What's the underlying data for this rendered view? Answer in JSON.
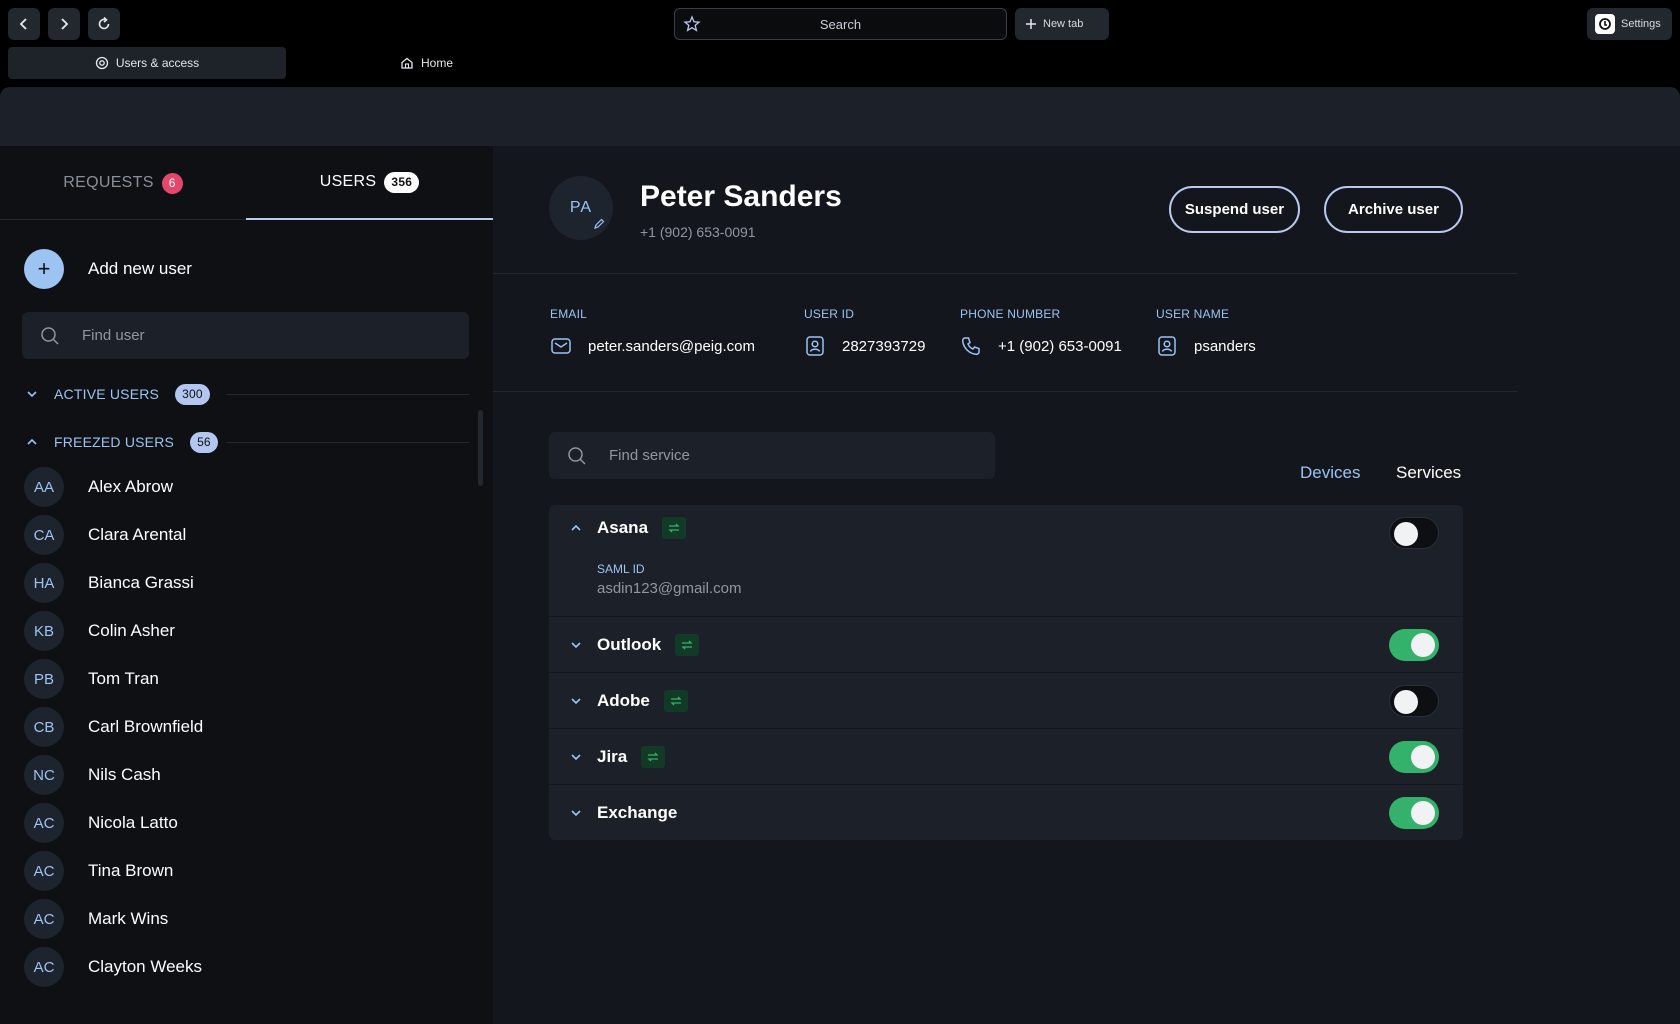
{
  "browser": {
    "search_label": "Search",
    "new_tab_label": "New tab",
    "settings_label": "Settings",
    "tabs": [
      {
        "label": "Users & access",
        "icon": "gear-icon",
        "active": true
      },
      {
        "label": "Home",
        "icon": "home-icon",
        "active": false
      }
    ]
  },
  "sidebar": {
    "tabs": [
      {
        "label": "REQUESTS",
        "count": "6"
      },
      {
        "label": "USERS",
        "count": "356"
      }
    ],
    "add_user_label": "Add new user",
    "find_user_placeholder": "Find user",
    "groups": [
      {
        "label": "ACTIVE USERS",
        "count": "300",
        "expanded": false
      },
      {
        "label": "FREEZED USERS",
        "count": "56",
        "expanded": true
      }
    ],
    "users": [
      {
        "initials": "AA",
        "name": "Alex Abrow"
      },
      {
        "initials": "CA",
        "name": "Clara Arental"
      },
      {
        "initials": "HA",
        "name": "Bianca Grassi"
      },
      {
        "initials": "KB",
        "name": "Colin Asher"
      },
      {
        "initials": "PB",
        "name": "Tom Tran"
      },
      {
        "initials": "CB",
        "name": "Carl Brownfield"
      },
      {
        "initials": "NC",
        "name": "Nils Cash"
      },
      {
        "initials": "AC",
        "name": "Nicola Latto"
      },
      {
        "initials": "AC",
        "name": "Tina Brown"
      },
      {
        "initials": "AC",
        "name": "Mark Wins"
      },
      {
        "initials": "AC",
        "name": "Clayton Weeks"
      }
    ]
  },
  "profile": {
    "initials": "PA",
    "name": "Peter Sanders",
    "phone": "+1 (902) 653-0091",
    "suspend_label": "Suspend user",
    "archive_label": "Archive user",
    "fields": [
      {
        "label": "EMAIL",
        "value": "peter.sanders@peig.com",
        "icon": "mail-icon"
      },
      {
        "label": "USER ID",
        "value": "2827393729",
        "icon": "id-card-icon"
      },
      {
        "label": "PHONE NUMBER",
        "value": "+1 (902) 653-0091",
        "icon": "phone-icon"
      },
      {
        "label": "USER NAME",
        "value": "psanders",
        "icon": "user-card-icon"
      }
    ]
  },
  "services": {
    "find_placeholder": "Find service",
    "tabs": [
      {
        "label": "Devices",
        "active": true
      },
      {
        "label": "Services",
        "active": false
      }
    ],
    "items": [
      {
        "name": "Asana",
        "expanded": true,
        "enabled": false,
        "saml_label": "SAML ID",
        "saml_value": "asdin123@gmail.com"
      },
      {
        "name": "Outlook",
        "expanded": false,
        "enabled": true
      },
      {
        "name": "Adobe",
        "expanded": false,
        "enabled": false
      },
      {
        "name": "Jira",
        "expanded": false,
        "enabled": true
      },
      {
        "name": "Exchange",
        "expanded": false,
        "enabled": true
      }
    ]
  },
  "colors": {
    "accent": "#9cc3f2",
    "toggle_on": "#34b26b",
    "badge_red": "#e4476b"
  }
}
